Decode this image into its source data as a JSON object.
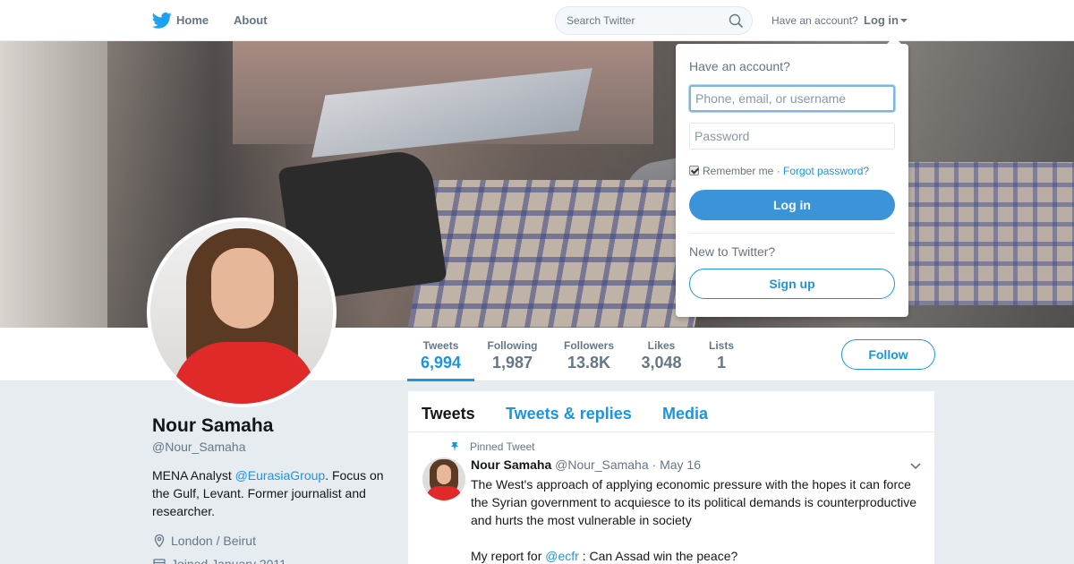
{
  "nav": {
    "home_label": "Home",
    "about_label": "About",
    "search_placeholder": "Search Twitter",
    "have_account": "Have an account?",
    "login_label": "Log in"
  },
  "profile": {
    "name": "Nour Samaha",
    "handle": "@Nour_Samaha",
    "bio_prefix": "MENA Analyst ",
    "bio_link": "@EurasiaGroup",
    "bio_suffix": ". Focus on the Gulf, Levant. Former journalist and researcher.",
    "location": "London / Beirut",
    "joined": "Joined January 2011"
  },
  "stats": [
    {
      "label": "Tweets",
      "value": "6,994",
      "active": true
    },
    {
      "label": "Following",
      "value": "1,987"
    },
    {
      "label": "Followers",
      "value": "13.8K"
    },
    {
      "label": "Likes",
      "value": "3,048"
    },
    {
      "label": "Lists",
      "value": "1"
    }
  ],
  "follow_label": "Follow",
  "timeline": {
    "tabs": [
      "Tweets",
      "Tweets & replies",
      "Media"
    ],
    "pinned_label": "Pinned Tweet",
    "tweet": {
      "name": "Nour Samaha",
      "handle": "@Nour_Samaha",
      "date": "· May 16",
      "text": "The West's approach of applying economic pressure with the hopes it can force the Syrian government to acquiesce to its political demands is counterproductive and hurts the most vulnerable in society",
      "text2_prefix": "My report for ",
      "text2_link": "@ecfr",
      "text2_suffix": " : Can Assad win the peace?"
    }
  },
  "login_dropdown": {
    "title": "Have an account?",
    "username_placeholder": "Phone, email, or username",
    "password_placeholder": "Password",
    "remember_label": "Remember me",
    "separator": " · ",
    "forgot_label": "Forgot password?",
    "login_button": "Log in",
    "new_label": "New to Twitter?",
    "signup_button": "Sign up"
  },
  "colors": {
    "accent": "#1b95e0",
    "login_button": "#3b94d9",
    "page_bg": "#e6ecf0"
  }
}
